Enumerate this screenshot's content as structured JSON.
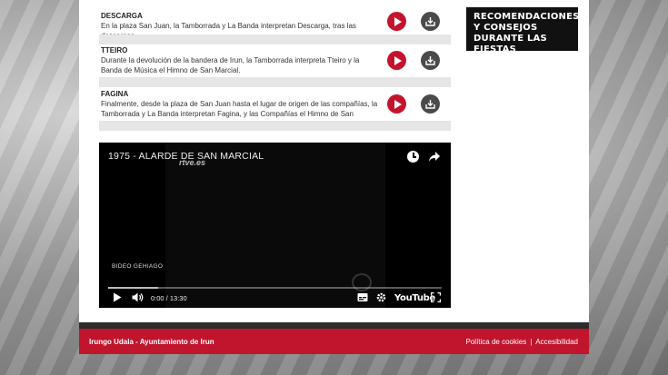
{
  "tracks": [
    {
      "name": "DESCARGA",
      "desc": "En la plaza San Juan, la Tamborrada y La Banda interpretan Descarga, tras las descargas."
    },
    {
      "name": "TTEIRO",
      "desc": "Durante la devolución de la bandera de Irun, la Tamborrada interpreta Tteiro y la Banda de Música el Himno de San Marcial."
    },
    {
      "name": "FAGINA",
      "desc": "Finalmente, desde la plaza de San Juan hasta el lugar de origen de las compañías, la Tamborrada y La Banda interpretan Fagina, y las Compañías el Himno de San Marcial."
    }
  ],
  "sidebar": {
    "title": "RECOMENDACIONES Y CONSEJOS DURANTE LAS FIESTAS"
  },
  "video": {
    "title": "1975 - ALARDE DE SAN MARCIAL",
    "channel_logo": "rtve.es",
    "subtag": "BIDEO GEHIAGO",
    "time": "0:00 / 13:30",
    "brand": "YouTube",
    "buffered": 0.15
  },
  "footer": {
    "left": "Irungo Udala - Ayuntamiento de Irun",
    "cookies": "Política de cookies",
    "divider": "|",
    "accessibility": "Accesibilidad"
  },
  "colors": {
    "accent": "#c0152d",
    "play": "#c4142c",
    "download": "#4a4a4a"
  }
}
